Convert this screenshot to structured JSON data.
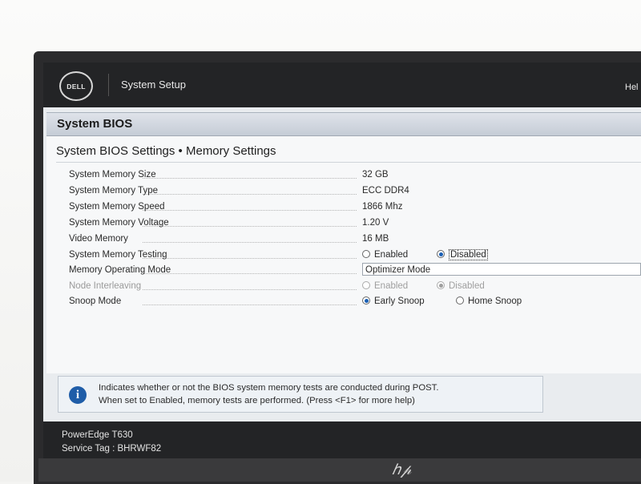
{
  "topbar": {
    "brand": "DELL",
    "app_title": "System Setup",
    "help_link": "Hel"
  },
  "section": {
    "title": "System BIOS"
  },
  "page": {
    "title": "System BIOS Settings • Memory Settings"
  },
  "settings": [
    {
      "label": "System Memory Size",
      "value": "32 GB"
    },
    {
      "label": "System Memory Type",
      "value": "ECC DDR4"
    },
    {
      "label": "System Memory Speed",
      "value": "1866 Mhz"
    },
    {
      "label": "System Memory Voltage",
      "value": "1.20 V"
    },
    {
      "label": "Video Memory",
      "value": "16 MB"
    },
    {
      "label": "System Memory Testing",
      "options": [
        "Enabled",
        "Disabled"
      ],
      "selected": "Disabled"
    },
    {
      "label": "Memory Operating Mode",
      "value": "Optimizer Mode"
    },
    {
      "label": "Node Interleaving",
      "options": [
        "Enabled",
        "Disabled"
      ],
      "selected": "Disabled",
      "disabled": true
    },
    {
      "label": "Snoop Mode",
      "options": [
        "Early Snoop",
        "Home Snoop"
      ],
      "selected": "Early Snoop"
    }
  ],
  "help": {
    "line1": "Indicates whether or not the BIOS system memory tests are conducted during POST.",
    "line2": "When set to Enabled, memory tests are performed. (Press <F1> for more help)"
  },
  "footer": {
    "model": "PowerEdge T630",
    "service_tag": "Service Tag : BHRWF82"
  },
  "monitor": {
    "brand_icon": "hp-logo-icon"
  },
  "colors": {
    "header_bar": "#232426",
    "accent_blue": "#1f5da8",
    "section_header": "#c5ccd6"
  }
}
